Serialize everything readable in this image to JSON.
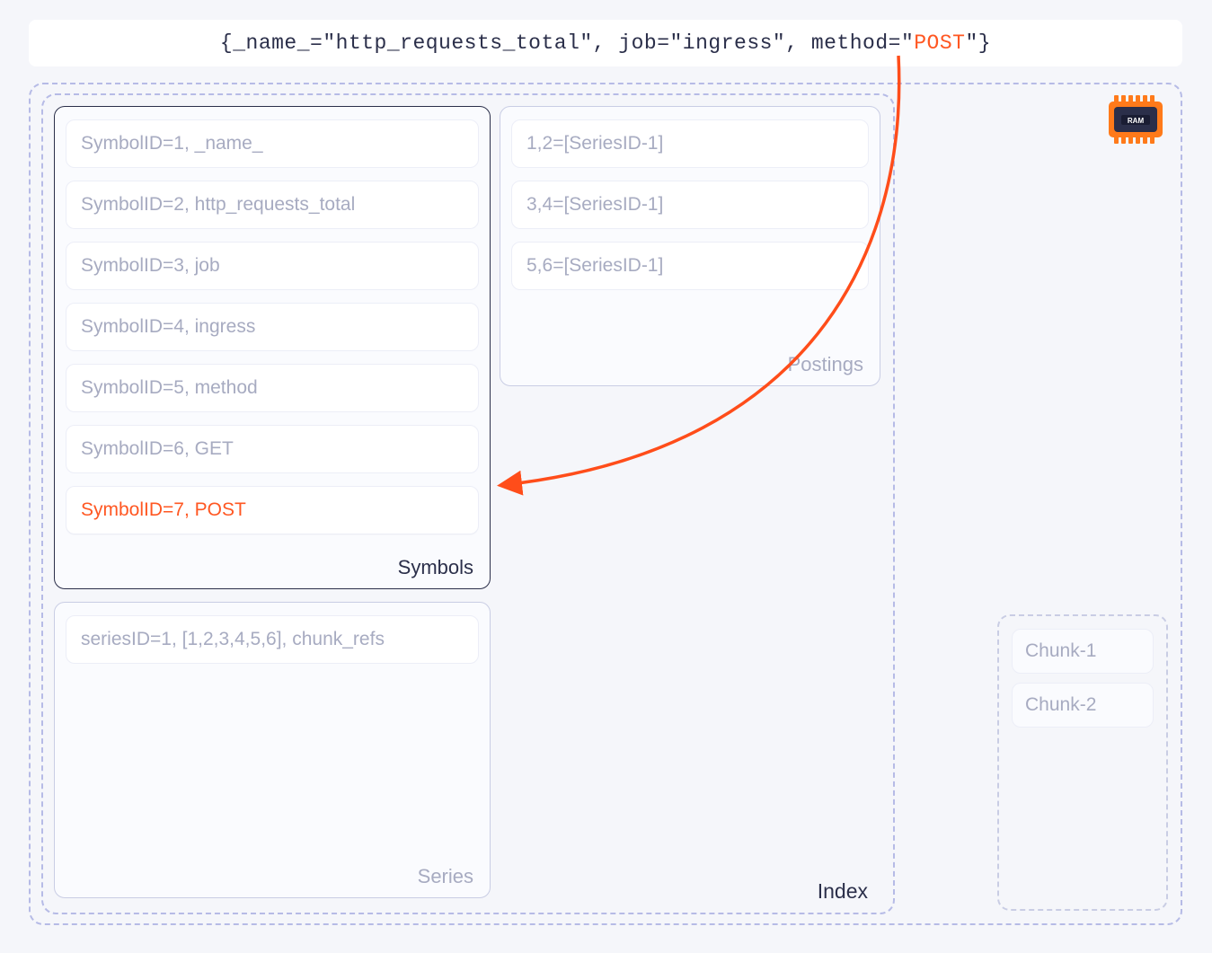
{
  "query": {
    "prefix": "{_name_=\"http_requests_total\", job=\"ingress\", method=\"",
    "highlight": "POST",
    "suffix": "\"}"
  },
  "index": {
    "label": "Index",
    "symbols": {
      "label": "Symbols",
      "rows": [
        "SymbolID=1, _name_",
        "SymbolID=2, http_requests_total",
        "SymbolID=3, job",
        "SymbolID=4, ingress",
        "SymbolID=5, method",
        "SymbolID=6, GET",
        "SymbolID=7, POST"
      ],
      "highlight_index": 6
    },
    "postings": {
      "label": "Postings",
      "rows": [
        "1,2=[SeriesID-1]",
        "3,4=[SeriesID-1]",
        "5,6=[SeriesID-1]"
      ]
    },
    "series": {
      "label": "Series",
      "rows": [
        "seriesID=1, [1,2,3,4,5,6], chunk_refs"
      ]
    }
  },
  "chunks": {
    "items": [
      "Chunk-1",
      "Chunk-2"
    ]
  },
  "ram_badge": "RAM",
  "colors": {
    "highlight": "#ff5722",
    "dashed_border": "#b6bbe6",
    "text_dark": "#2b2f4a",
    "text_dim": "#a7abc1"
  }
}
